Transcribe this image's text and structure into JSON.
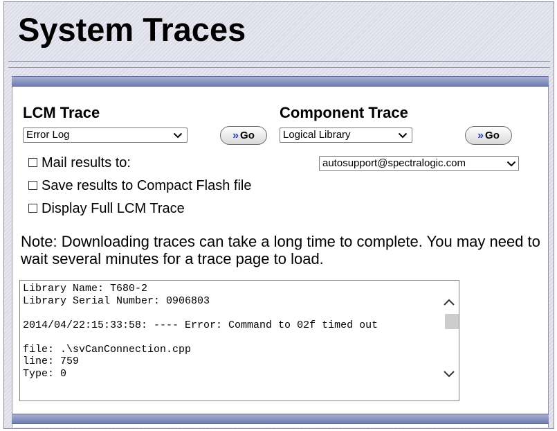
{
  "page": {
    "title": "System Traces"
  },
  "lcm_trace": {
    "label": "LCM Trace",
    "selected": "Error Log",
    "go_label": "Go"
  },
  "component_trace": {
    "label": "Component Trace",
    "selected": "Logical Library",
    "go_label": "Go"
  },
  "options": {
    "mail_label": "Mail results to:",
    "mail_address": "autosupport@spectralogic.com",
    "save_label": "Save results to Compact Flash file",
    "display_label": "Display Full LCM Trace"
  },
  "note": "Note: Downloading traces can take a long time to complete. You may need to wait several minutes for a trace page to load.",
  "trace_output": "Library Name: T680-2\nLibrary Serial Number: 0906803\n\n2014/04/22:15:33:58: ---- Error: Command to 02f timed out\n\nfile: .\\svCanConnection.cpp\nline: 759\nType: 0",
  "icons": {
    "go_arrow": "double-chevron-right-icon",
    "dropdown": "chevron-down-icon"
  },
  "colors": {
    "bar": "#6f7cb0",
    "go_arrow": "#2b3fae"
  }
}
